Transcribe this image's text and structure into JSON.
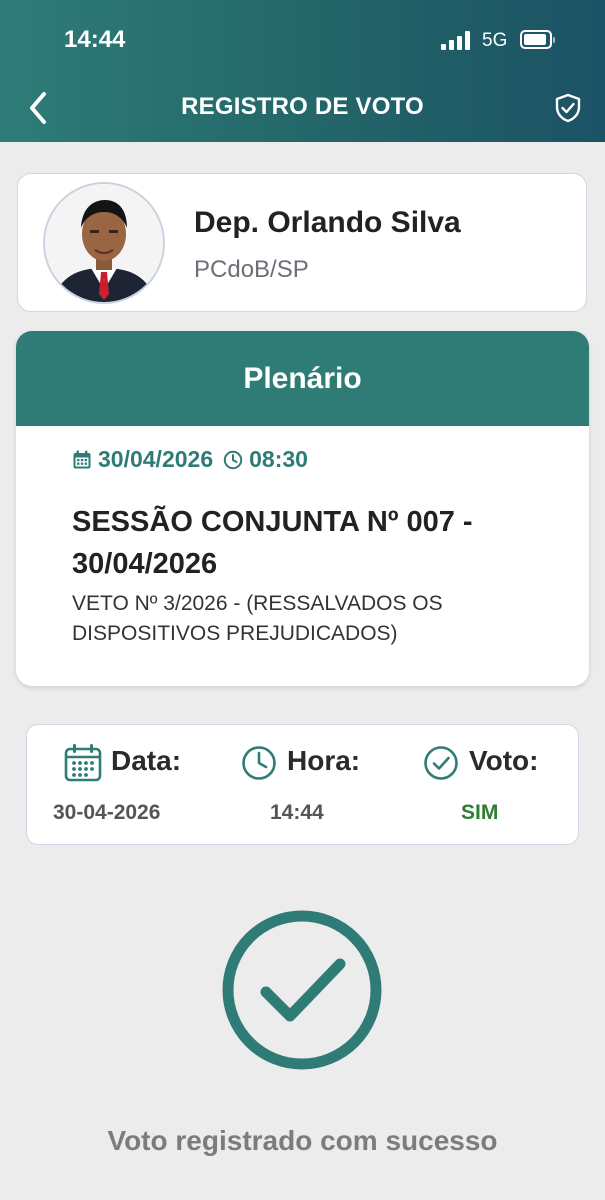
{
  "status_bar": {
    "time": "14:44",
    "network": "5G"
  },
  "nav": {
    "title": "REGISTRO DE VOTO",
    "back_icon": "chevron-left-icon",
    "right_icon": "shield-check-icon"
  },
  "deputy": {
    "name": "Dep. Orlando Silva",
    "party": "PCdoB/SP"
  },
  "session": {
    "location": "Plenário",
    "date": "30/04/2026",
    "time": "08:30",
    "title": "SESSÃO CONJUNTA Nº 007 - 30/04/2026",
    "description": "VETO Nº 3/2026 - (RESSALVADOS OS DISPOSITIVOS PREJUDICADOS)"
  },
  "vote_info": {
    "date_label": "Data:",
    "date_value": "30-04-2026",
    "time_label": "Hora:",
    "time_value": "14:44",
    "vote_label": "Voto:",
    "vote_value": "SIM"
  },
  "confirmation": {
    "message": "Voto registrado com sucesso"
  },
  "colors": {
    "primary": "#2f7c76",
    "vote_value": "#2e7d32",
    "muted_text": "#7c7c7c"
  }
}
